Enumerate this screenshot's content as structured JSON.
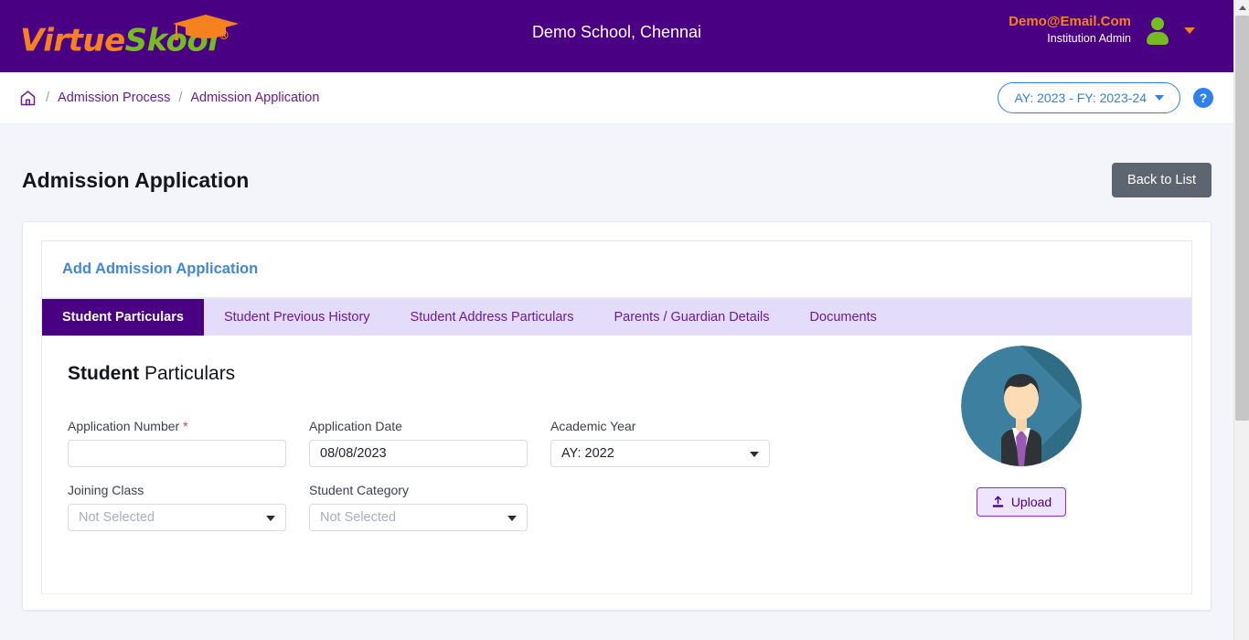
{
  "brand": {
    "name_part1": "Virtue",
    "name_part2": "Skool",
    "registered_mark": "®",
    "colors": {
      "orange": "#f5821f",
      "green": "#76bc21",
      "purple": "#4a0082"
    }
  },
  "header": {
    "school_title": "Demo School, Chennai",
    "user_email": "Demo@Email.Com",
    "user_role": "Institution Admin"
  },
  "breadcrumb": {
    "home_icon": "home-icon",
    "separator": "/",
    "items": [
      {
        "label": "Admission Process"
      },
      {
        "label": "Admission Application"
      }
    ],
    "academic_year_button": "AY: 2023 - FY: 2023-24",
    "help_label": "?"
  },
  "page": {
    "title": "Admission Application",
    "back_button": "Back to List"
  },
  "card": {
    "section_title": "Add Admission Application",
    "tabs": [
      {
        "label": "Student Particulars",
        "active": true
      },
      {
        "label": "Student Previous History",
        "active": false
      },
      {
        "label": "Student Address Particulars",
        "active": false
      },
      {
        "label": "Parents / Guardian Details",
        "active": false
      },
      {
        "label": "Documents",
        "active": false
      }
    ],
    "panel": {
      "title_bold": "Student",
      "title_rest": " Particulars",
      "fields": {
        "application_number": {
          "label": "Application Number",
          "required_marker": "*",
          "value": "",
          "placeholder": ""
        },
        "application_date": {
          "label": "Application Date",
          "value": "08/08/2023",
          "placeholder": ""
        },
        "academic_year": {
          "label": "Academic Year",
          "value": "AY: 2022",
          "placeholder": ""
        },
        "joining_class": {
          "label": "Joining Class",
          "value": "",
          "placeholder": "Not Selected"
        },
        "student_category": {
          "label": "Student Category",
          "value": "",
          "placeholder": "Not Selected"
        }
      },
      "photo": {
        "alt_name": "student-photo-placeholder",
        "upload_label": "Upload",
        "upload_icon": "upload-icon"
      }
    }
  }
}
